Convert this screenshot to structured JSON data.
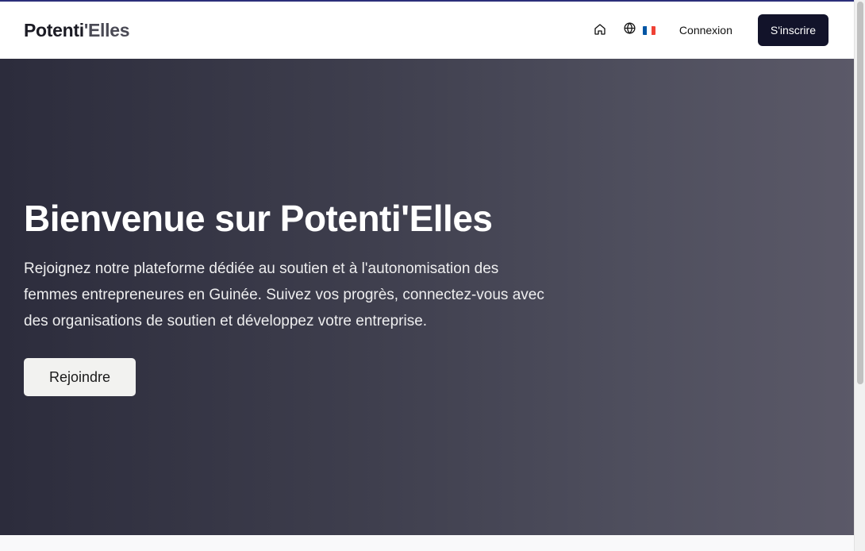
{
  "header": {
    "logo_part1": "Potenti",
    "logo_part2": "'Elles",
    "home_icon": "home-icon",
    "language_icon": "globe-icon",
    "flag_colors": [
      "#0055A4",
      "#FFFFFF",
      "#EF4135"
    ],
    "login_label": "Connexion",
    "signup_label": "S'inscrire"
  },
  "hero": {
    "title": "Bienvenue sur Potenti'Elles",
    "description": "Rejoignez notre plateforme dédiée au soutien et à l'autonomisation des femmes entrepreneures en Guinée. Suivez vos progrès, connectez-vous avec des organisations de soutien et développez votre entreprise.",
    "join_label": "Rejoindre"
  },
  "colors": {
    "accent_bar": "#2b2f7a",
    "signup_bg": "#12132a",
    "hero_gradient_start": "#2c2c3c",
    "hero_gradient_end": "#5b5968"
  }
}
